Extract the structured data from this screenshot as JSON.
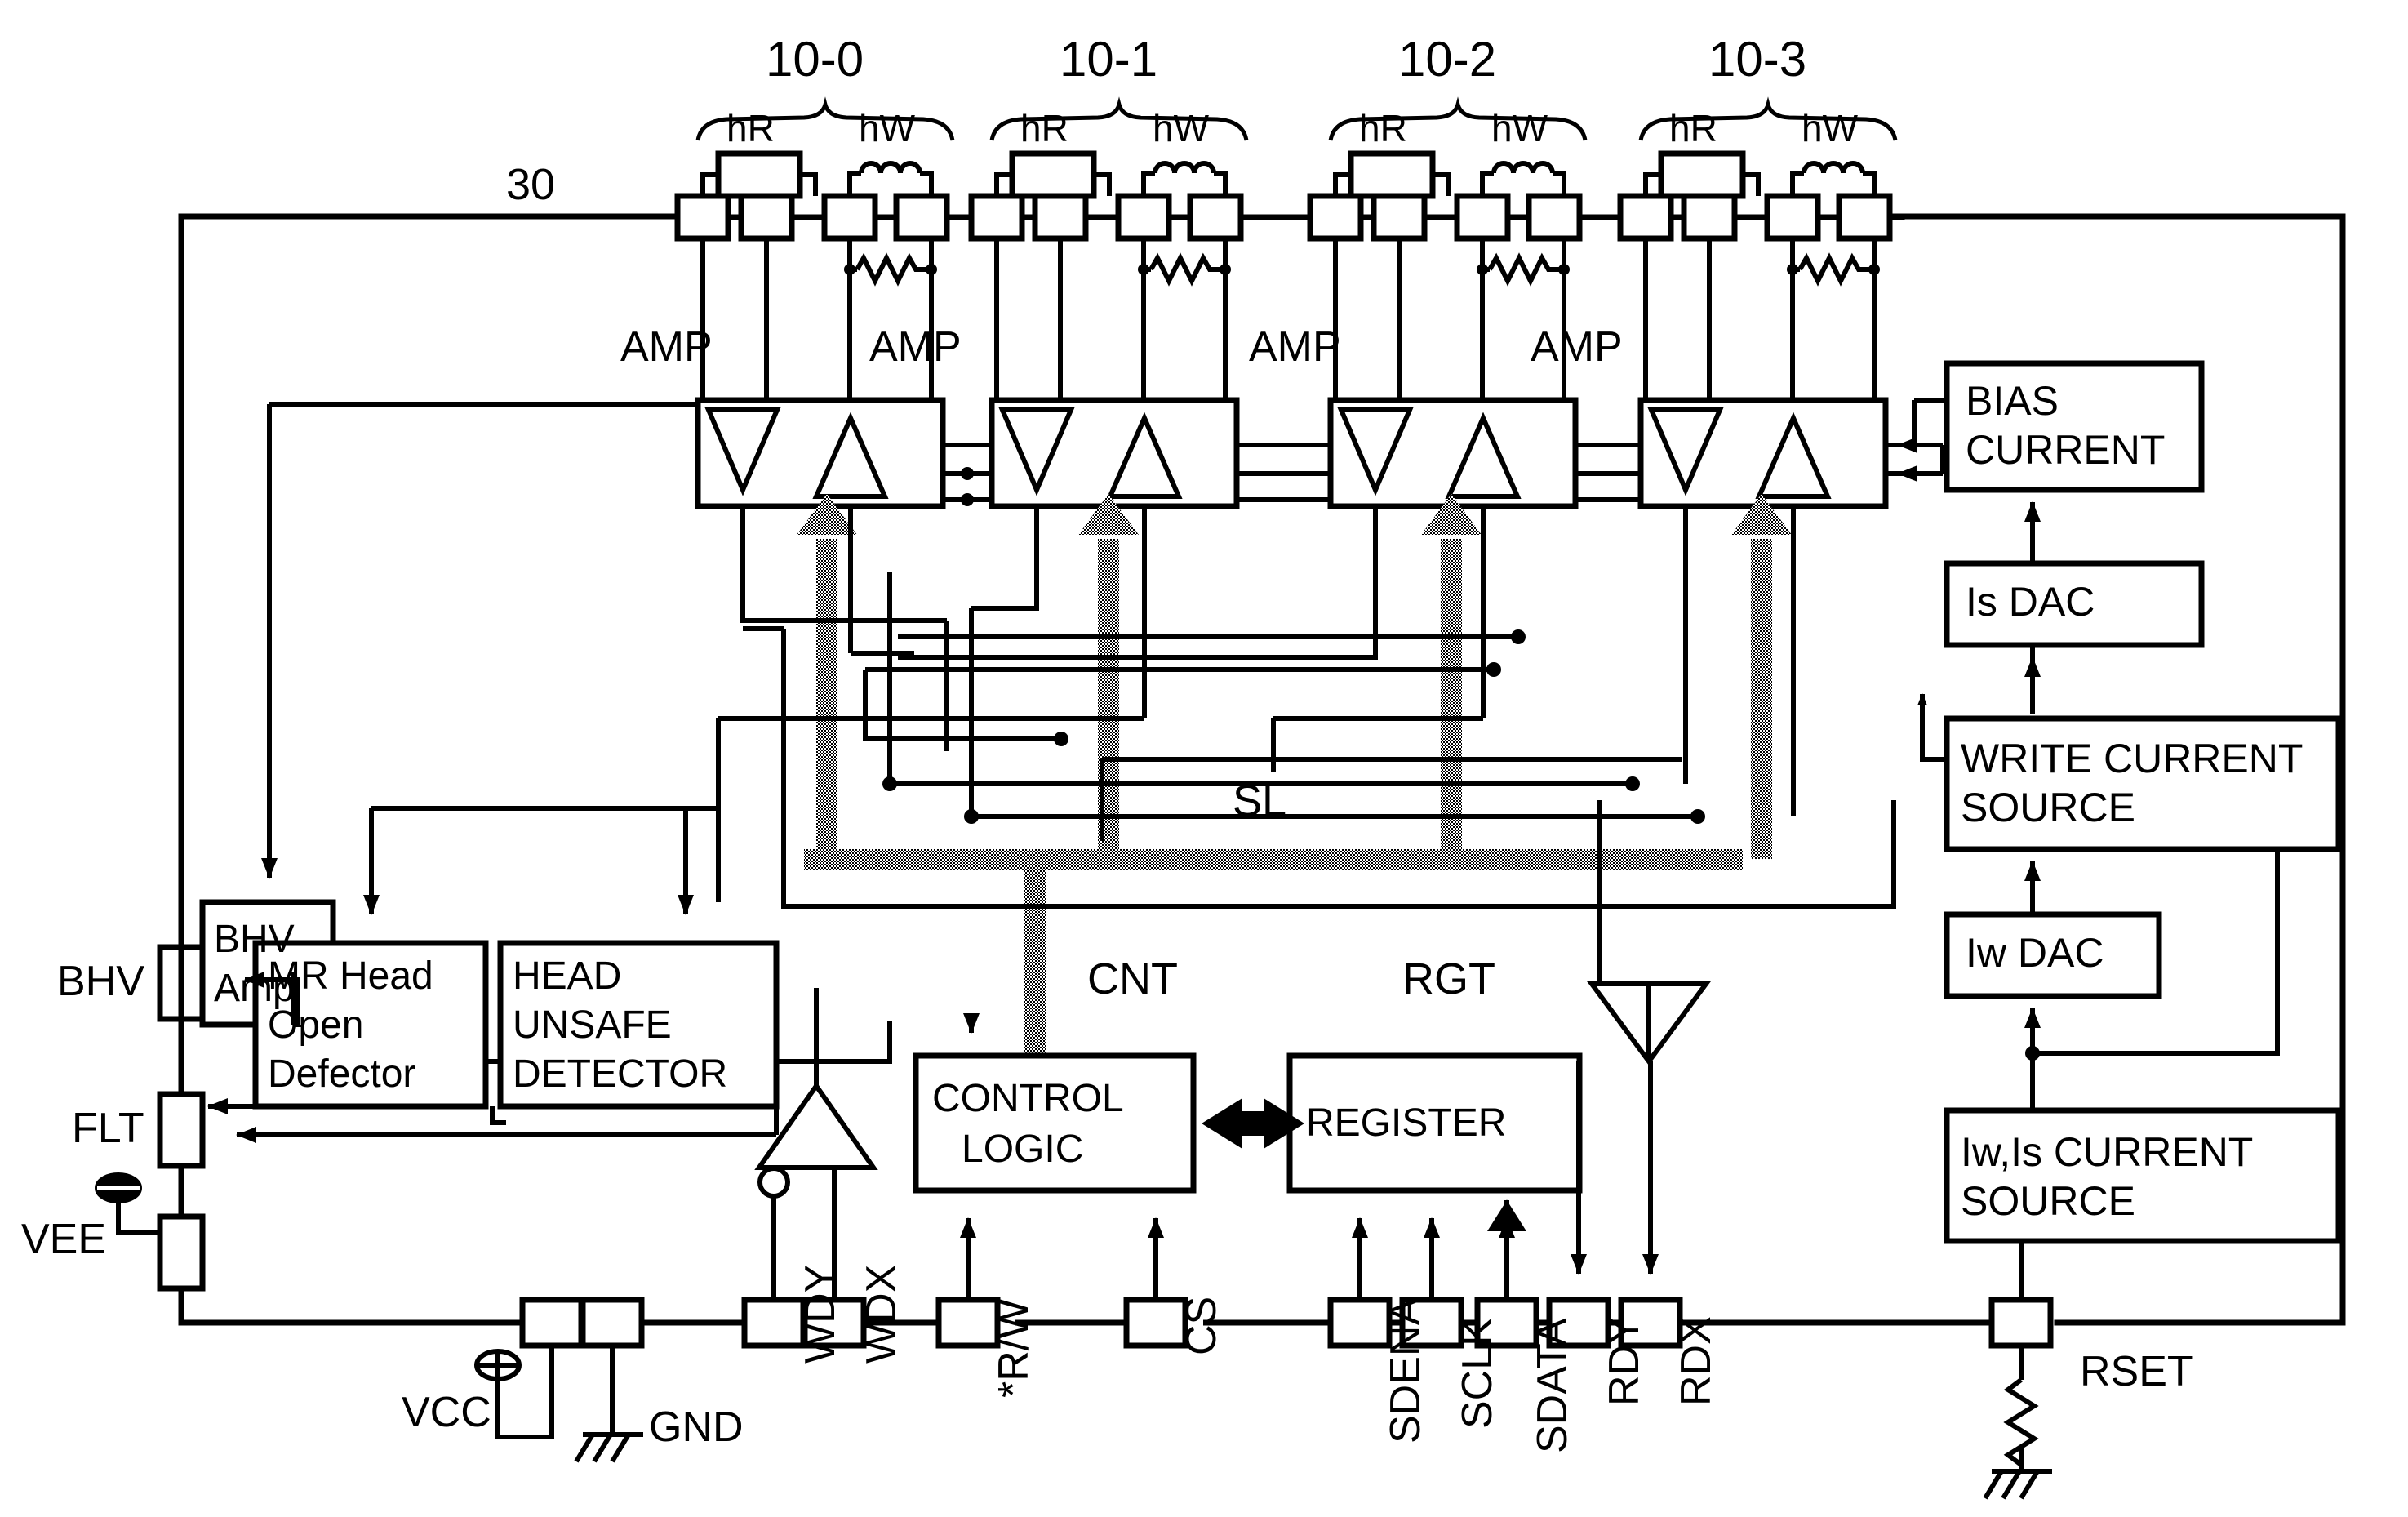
{
  "figure": {
    "type": "circuit-block-diagram",
    "reference_numerals": {
      "head_assembly": "30",
      "control_logic": "CNT",
      "register": "RGT",
      "serial_bus": "SL"
    }
  },
  "heads": {
    "group_labels": [
      "10-0",
      "10-1",
      "10-2",
      "10-3"
    ],
    "read_element_label": "hR",
    "write_element_label": "hW",
    "amp_label": "AMP"
  },
  "blocks": {
    "bhv_amp": "BHV\nAmp",
    "bhv_amp_line1": "BHV",
    "bhv_amp_line2": "Amp",
    "mr_head_open_detector_l1": "MR Head",
    "mr_head_open_detector_l2": "Open",
    "mr_head_open_detector_l3": "Defector",
    "head_unsafe_detector_l1": "HEAD",
    "head_unsafe_detector_l2": "UNSAFE",
    "head_unsafe_detector_l3": "DETECTOR",
    "control_logic_l1": "CONTROL",
    "control_logic_l2": "LOGIC",
    "register": "REGISTER",
    "bias_current_l1": "BIAS",
    "bias_current_l2": "CURRENT",
    "is_dac": "Is DAC",
    "write_current_source_l1": "WRITE CURRENT",
    "write_current_source_l2": "SOURCE",
    "iw_dac": "Iw DAC",
    "iw_is_current_source_l1": "Iw,Is CURRENT",
    "iw_is_current_source_l2": "SOURCE"
  },
  "pins": {
    "left": [
      "BHV",
      "FLT",
      "VEE"
    ],
    "bottom": [
      "VCC",
      "GND",
      "WDY",
      "WDX",
      "*R/W",
      "CS",
      "SDENA",
      "SCLK",
      "SDATA",
      "RDY",
      "RDX",
      "RSET"
    ]
  },
  "colors": {
    "ink": "#000000",
    "bus_gray": "#8a8a8a",
    "background": "#ffffff"
  }
}
